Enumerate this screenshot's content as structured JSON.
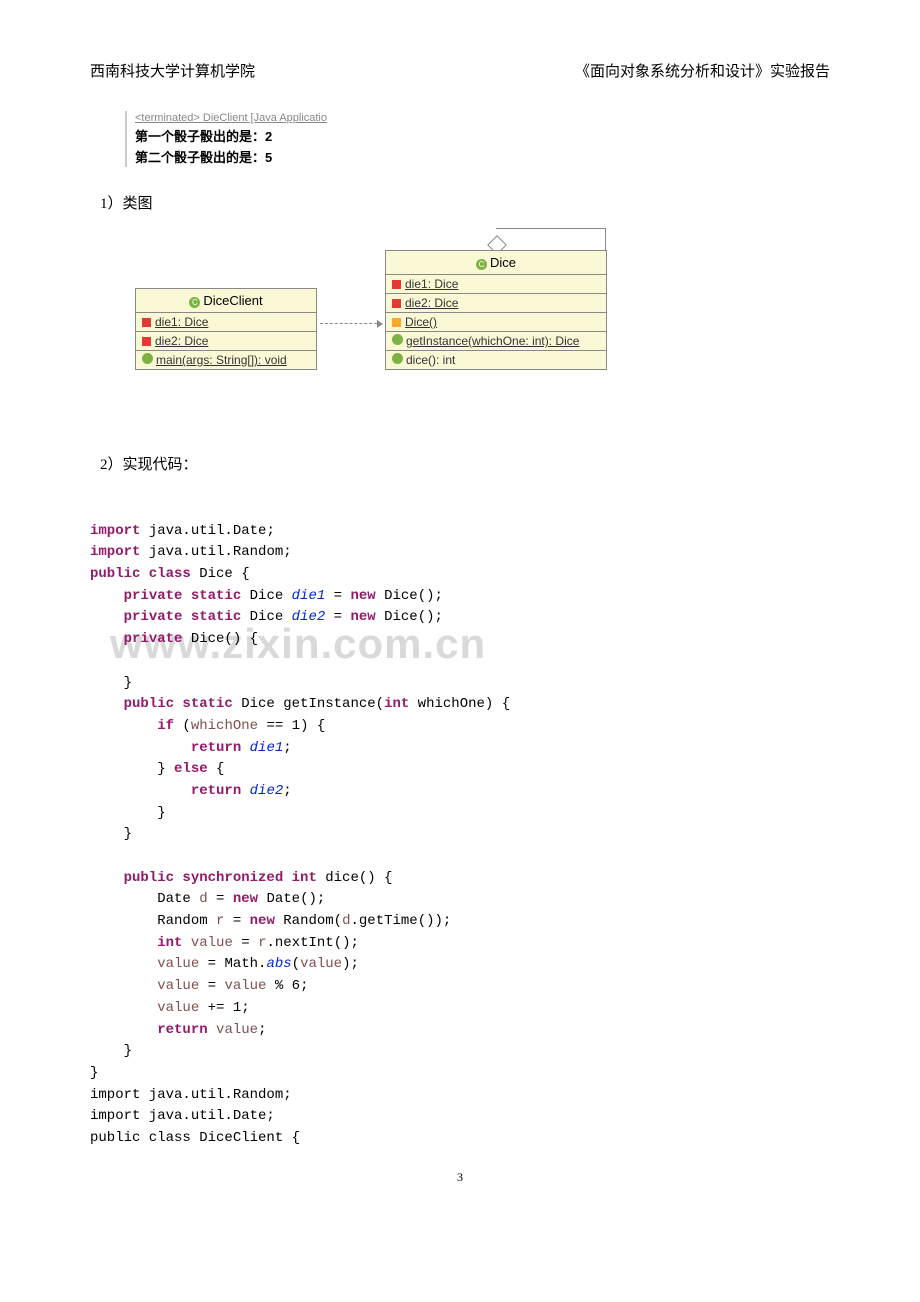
{
  "header": {
    "left": "西南科技大学计算机学院",
    "right": "《面向对象系统分析和设计》实验报告"
  },
  "console": {
    "terminated": "<terminated> DieClient [Java Applicatio",
    "line1": "第一个骰子骰出的是：2",
    "line2": "第二个骰子骰出的是：5"
  },
  "sections": {
    "classDiagram": "1）类图",
    "implCode": "2）实现代码："
  },
  "uml": {
    "left": {
      "title": "DiceClient",
      "attr1": "die1: Dice",
      "attr2": "die2: Dice",
      "op1": "main(args: String[]): void"
    },
    "right": {
      "title": "Dice",
      "attr1": "die1: Dice",
      "attr2": "die2: Dice",
      "op1": "Dice()",
      "op2": "getInstance(whichOne: int): Dice",
      "op3": "dice(): int"
    }
  },
  "code": {
    "l1_kw1": "import",
    "l1_t": " java.util.Date;",
    "l2_kw1": "import",
    "l2_t": " java.util.Random;",
    "l3_kw1": "public class",
    "l3_t": " Dice {",
    "l4_kw1": "private static",
    "l4_t1": " Dice ",
    "l4_v": "die1",
    "l4_t2": " = ",
    "l4_kw2": "new",
    "l4_t3": " Dice();",
    "l5_kw1": "private static",
    "l5_t1": " Dice ",
    "l5_v": "die2",
    "l5_t2": " = ",
    "l5_kw2": "new",
    "l5_t3": " Dice();",
    "l6_kw1": "private",
    "l6_t": " Dice() {",
    "l7_t": "    ",
    "l8_t": "    }",
    "l9_kw1": "public static",
    "l9_t1": " Dice getInstance(",
    "l9_kw2": "int",
    "l9_t2": " whichOne) {",
    "l10_kw1": "if",
    "l10_t1": " (",
    "l10_v": "whichOne",
    "l10_t2": " == 1) {",
    "l11_kw1": "return",
    "l11_t1": " ",
    "l11_v": "die1",
    "l11_t2": ";",
    "l12_t1": "} ",
    "l12_kw1": "else",
    "l12_t2": " {",
    "l13_kw1": "return",
    "l13_t1": " ",
    "l13_v": "die2",
    "l13_t2": ";",
    "l14_t": "        }",
    "l15_t": "    }",
    "l16_t": "",
    "l17_kw1": "public synchronized int",
    "l17_t": " dice() {",
    "l18_t1": "        Date ",
    "l18_v1": "d",
    "l18_t2": " = ",
    "l18_kw1": "new",
    "l18_t3": " Date();",
    "l19_t1": "        Random ",
    "l19_v1": "r",
    "l19_t2": " = ",
    "l19_kw1": "new",
    "l19_t3": " Random(",
    "l19_v2": "d",
    "l19_t4": ".getTime());",
    "l20_kw1": "int",
    "l20_t1": " ",
    "l20_v1": "value",
    "l20_t2": " = ",
    "l20_v2": "r",
    "l20_t3": ".nextInt();",
    "l21_v1": "value",
    "l21_t1": " = Math.",
    "l21_v2": "abs",
    "l21_t2": "(",
    "l21_v3": "value",
    "l21_t3": ");",
    "l22_v1": "value",
    "l22_t1": " = ",
    "l22_v2": "value",
    "l22_t2": " % 6;",
    "l23_v1": "value",
    "l23_t1": " += 1;",
    "l24_kw1": "return",
    "l24_t1": " ",
    "l24_v1": "value",
    "l24_t2": ";",
    "l25_t": "    }",
    "l26_t": "}",
    "l27_t": "import java.util.Random;",
    "l28_t": "import java.util.Date;",
    "l29_t": "public class DiceClient {"
  },
  "watermark": "www.zixin.com.cn",
  "pageNum": "3"
}
